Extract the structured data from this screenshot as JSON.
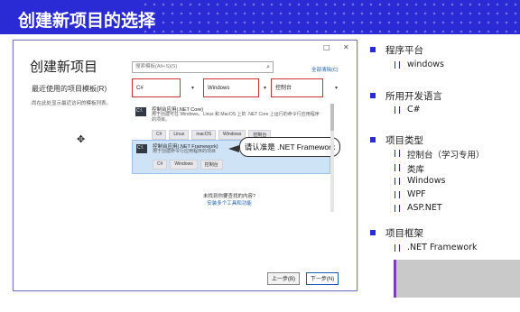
{
  "slide": {
    "title": "创建新项目的选择"
  },
  "dialog": {
    "window_controls": [
      "□",
      "✕"
    ],
    "title": "创建新项目",
    "recent_title": "最近使用的项目模板(R)",
    "recent_desc": "尚在此处显示最近访问的模板列表。",
    "search_placeholder": "搜索模板(Alt+S)(S)",
    "clear_all": "全部清除(C)",
    "filters": {
      "language": "C#",
      "platform": "Windows",
      "project_type": "控制台"
    },
    "templates": [
      {
        "name": "控制台应用(.NET Core)",
        "desc": "用于创建可在 Windows、Linux 和 MacOS 上的 .NET Core 上运行的命令行应用程序的项目。",
        "tags": [
          "C#",
          "Linux",
          "macOS",
          "Windows",
          "控制台"
        ],
        "selected": false
      },
      {
        "name": "控制台应用(.NET Framework)",
        "desc": "用于创建命令行应用程序的项目",
        "tags": [
          "C#",
          "Windows",
          "控制台"
        ],
        "selected": true
      }
    ],
    "callout": "请认准是 .NET Framework",
    "not_found": "未找到你要查找的内容?",
    "install_link": "安装多个工具和功能",
    "buttons": {
      "back": "上一步(B)",
      "next": "下一步(N)"
    }
  },
  "outline": [
    {
      "heading": "程序平台",
      "items": [
        "windows"
      ]
    },
    {
      "heading": "所用开发语言",
      "items": [
        "C#"
      ]
    },
    {
      "heading": "项目类型",
      "items": [
        "控制台（学习专用）",
        "类库",
        "Windows",
        "WPF",
        "ASP.NET"
      ]
    },
    {
      "heading": "项目框架",
      "items": [
        ".NET Framework"
      ]
    }
  ],
  "colors": {
    "header_bg": "#2b2bd6",
    "filter_border": "#cc3333",
    "selected_row": "#cfe3f7",
    "link": "#1a5fb4"
  }
}
